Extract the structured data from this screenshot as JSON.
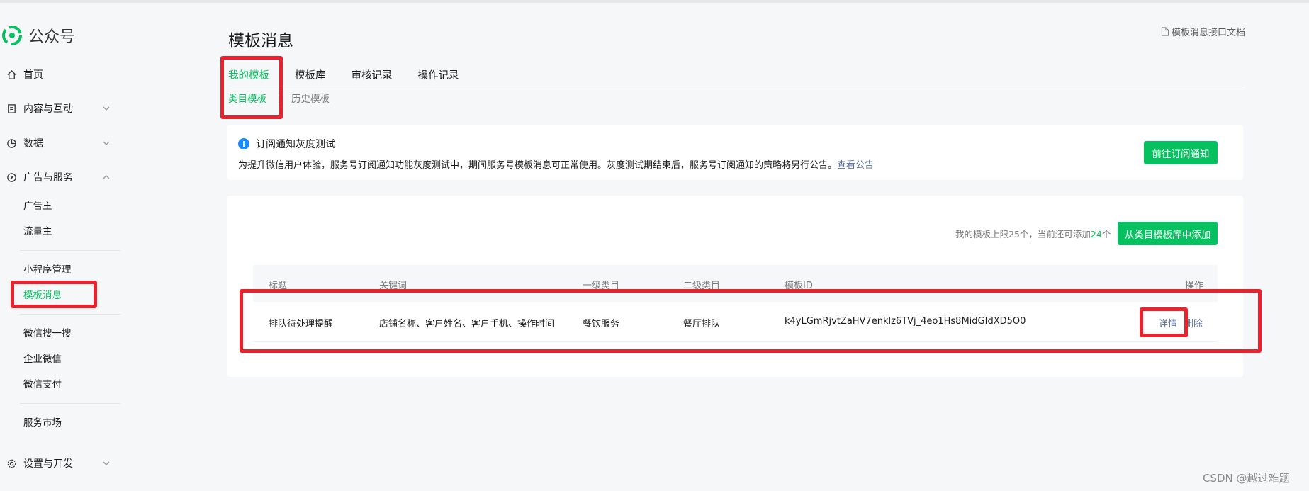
{
  "sidebar": {
    "logo_text": "公众号",
    "items": [
      {
        "label": "首页"
      },
      {
        "label": "内容与互动"
      },
      {
        "label": "数据"
      },
      {
        "label": "广告与服务"
      }
    ],
    "ad_sub": [
      "广告主",
      "流量主"
    ],
    "mini_sub": [
      "小程序管理",
      "模板消息"
    ],
    "more_sub": [
      "微信搜一搜",
      "企业微信",
      "微信支付"
    ],
    "market": "服务市场",
    "settings": "设置与开发"
  },
  "main": {
    "title": "模板消息",
    "doc_link": "模板消息接口文档",
    "tabs": [
      "我的模板",
      "模板库",
      "审核记录",
      "操作记录"
    ],
    "subtabs": [
      "类目模板",
      "历史模板"
    ]
  },
  "notice": {
    "title": "订阅通知灰度测试",
    "body": "为提升微信用户体验，服务号订阅通知功能灰度测试中，期间服务号模板消息可正常使用。灰度测试期结束后，服务号订阅通知的策略将另行公告。",
    "link": "查看公告",
    "button": "前往订阅通知"
  },
  "panel": {
    "limit_prefix": "我的模板上限25个，当前还可添加",
    "limit_count": "24",
    "limit_suffix": "个",
    "add_button": "从类目模板库中添加",
    "columns": [
      "标题",
      "关键词",
      "一级类目",
      "二级类目",
      "模板ID",
      "操作"
    ],
    "rows": [
      {
        "title": "排队待处理提醒",
        "keywords": "店铺名称、客户姓名、客户手机、操作时间",
        "cat1": "餐饮服务",
        "cat2": "餐厅排队",
        "id": "k4yLGmRjvtZaHV7enklz6TVj_4eo1Hs8MidGIdXD5O0",
        "detail": "详情",
        "delete": "删除"
      }
    ]
  },
  "watermark": "CSDN @越过难题",
  "colors": {
    "accent": "#07c160",
    "link": "#576b95",
    "highlight": "#e8232e",
    "info": "#1a8cff"
  }
}
